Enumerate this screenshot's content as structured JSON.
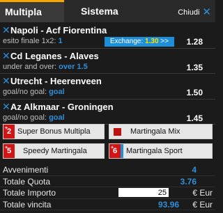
{
  "tabs": {
    "active": "Multipla",
    "other": "Sistema"
  },
  "close": {
    "label": "Chiudi",
    "icon": "✕"
  },
  "bets": [
    {
      "title": "Napoli - Acf Fiorentina",
      "market": "esito finale 1x2:",
      "pick": "1",
      "odd": "1.28",
      "exchange": {
        "label": "Exchange:",
        "value": "1.30",
        "arrow": ">>"
      }
    },
    {
      "title": "Cd Leganes - Alaves",
      "market": "under and over:",
      "pick": "over 1.5",
      "odd": "1.35"
    },
    {
      "title": "Utrecht - Heerenveen",
      "market": "goal/no goal:",
      "pick": "goal",
      "odd": "1.50"
    },
    {
      "title": "Az Alkmaar - Groningen",
      "market": "goal/no goal:",
      "pick": "goal",
      "odd": "1.45"
    }
  ],
  "bonus": {
    "super": {
      "badge": "2",
      "label": "Super Bonus Multipla"
    },
    "mix": {
      "label": "Martingala Mix"
    },
    "speedy": {
      "badge": "5",
      "label": "Speedy Martingala"
    },
    "sport": {
      "badge": "6",
      "label": "Martingala Sport"
    }
  },
  "summary": {
    "avvenimenti_label": "Avvenimenti",
    "avvenimenti_value": "4",
    "quota_label": "Totale Quota",
    "quota_value": "3.76",
    "importo_label": "Totale Importo",
    "importo_value": "25",
    "importo_unit": "€ Eur",
    "vincita_label": "Totale vincita",
    "vincita_value": "93.96",
    "vincita_unit": "€ Eur"
  },
  "colors": {
    "accent": "#2f8fd8",
    "tab_highlight": "#f5a800",
    "badge_red": "#d21414",
    "exchange_blue": "#1e8fd6"
  }
}
